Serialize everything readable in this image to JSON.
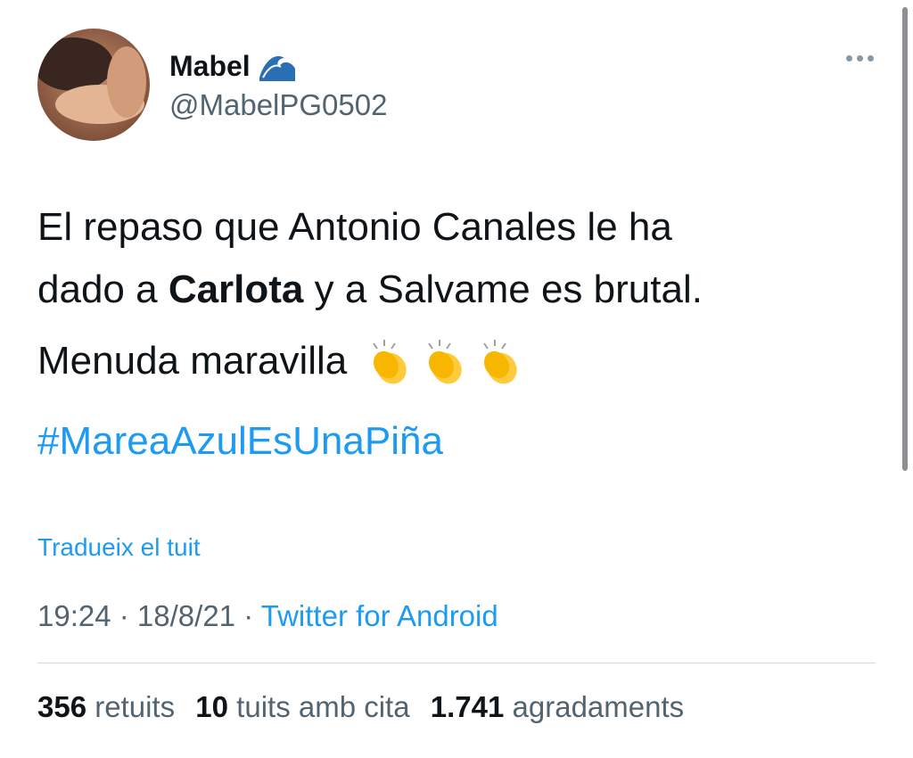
{
  "user": {
    "name": "Mabel",
    "handle": "@MabelPG0502"
  },
  "tweet": {
    "line1": "El repaso que Antonio Canales le ha",
    "line2_pre": "dado a ",
    "line2_bold": "Carlota",
    "line2_post": " y a Salvame es brutal.",
    "line3": "Menuda maravilla",
    "hashtag": "#MareaAzulEsUnaPiña"
  },
  "translate_label": "Tradueix el tuit",
  "meta": {
    "time": "19:24",
    "sep1": " · ",
    "date": "18/8/21",
    "sep2": " · ",
    "source": "Twitter for Android"
  },
  "stats": {
    "retweets_count": "356",
    "retweets_label": "retuits",
    "quotes_count": "10",
    "quotes_label": "tuits amb cita",
    "likes_count": "1.741",
    "likes_label": "agradaments"
  },
  "icons": {
    "name_badge": "wave-icon",
    "more": "more-icon",
    "clap": "clapping-hands-icon"
  },
  "colors": {
    "link": "#1d9bf0",
    "secondary_text": "#536471"
  }
}
